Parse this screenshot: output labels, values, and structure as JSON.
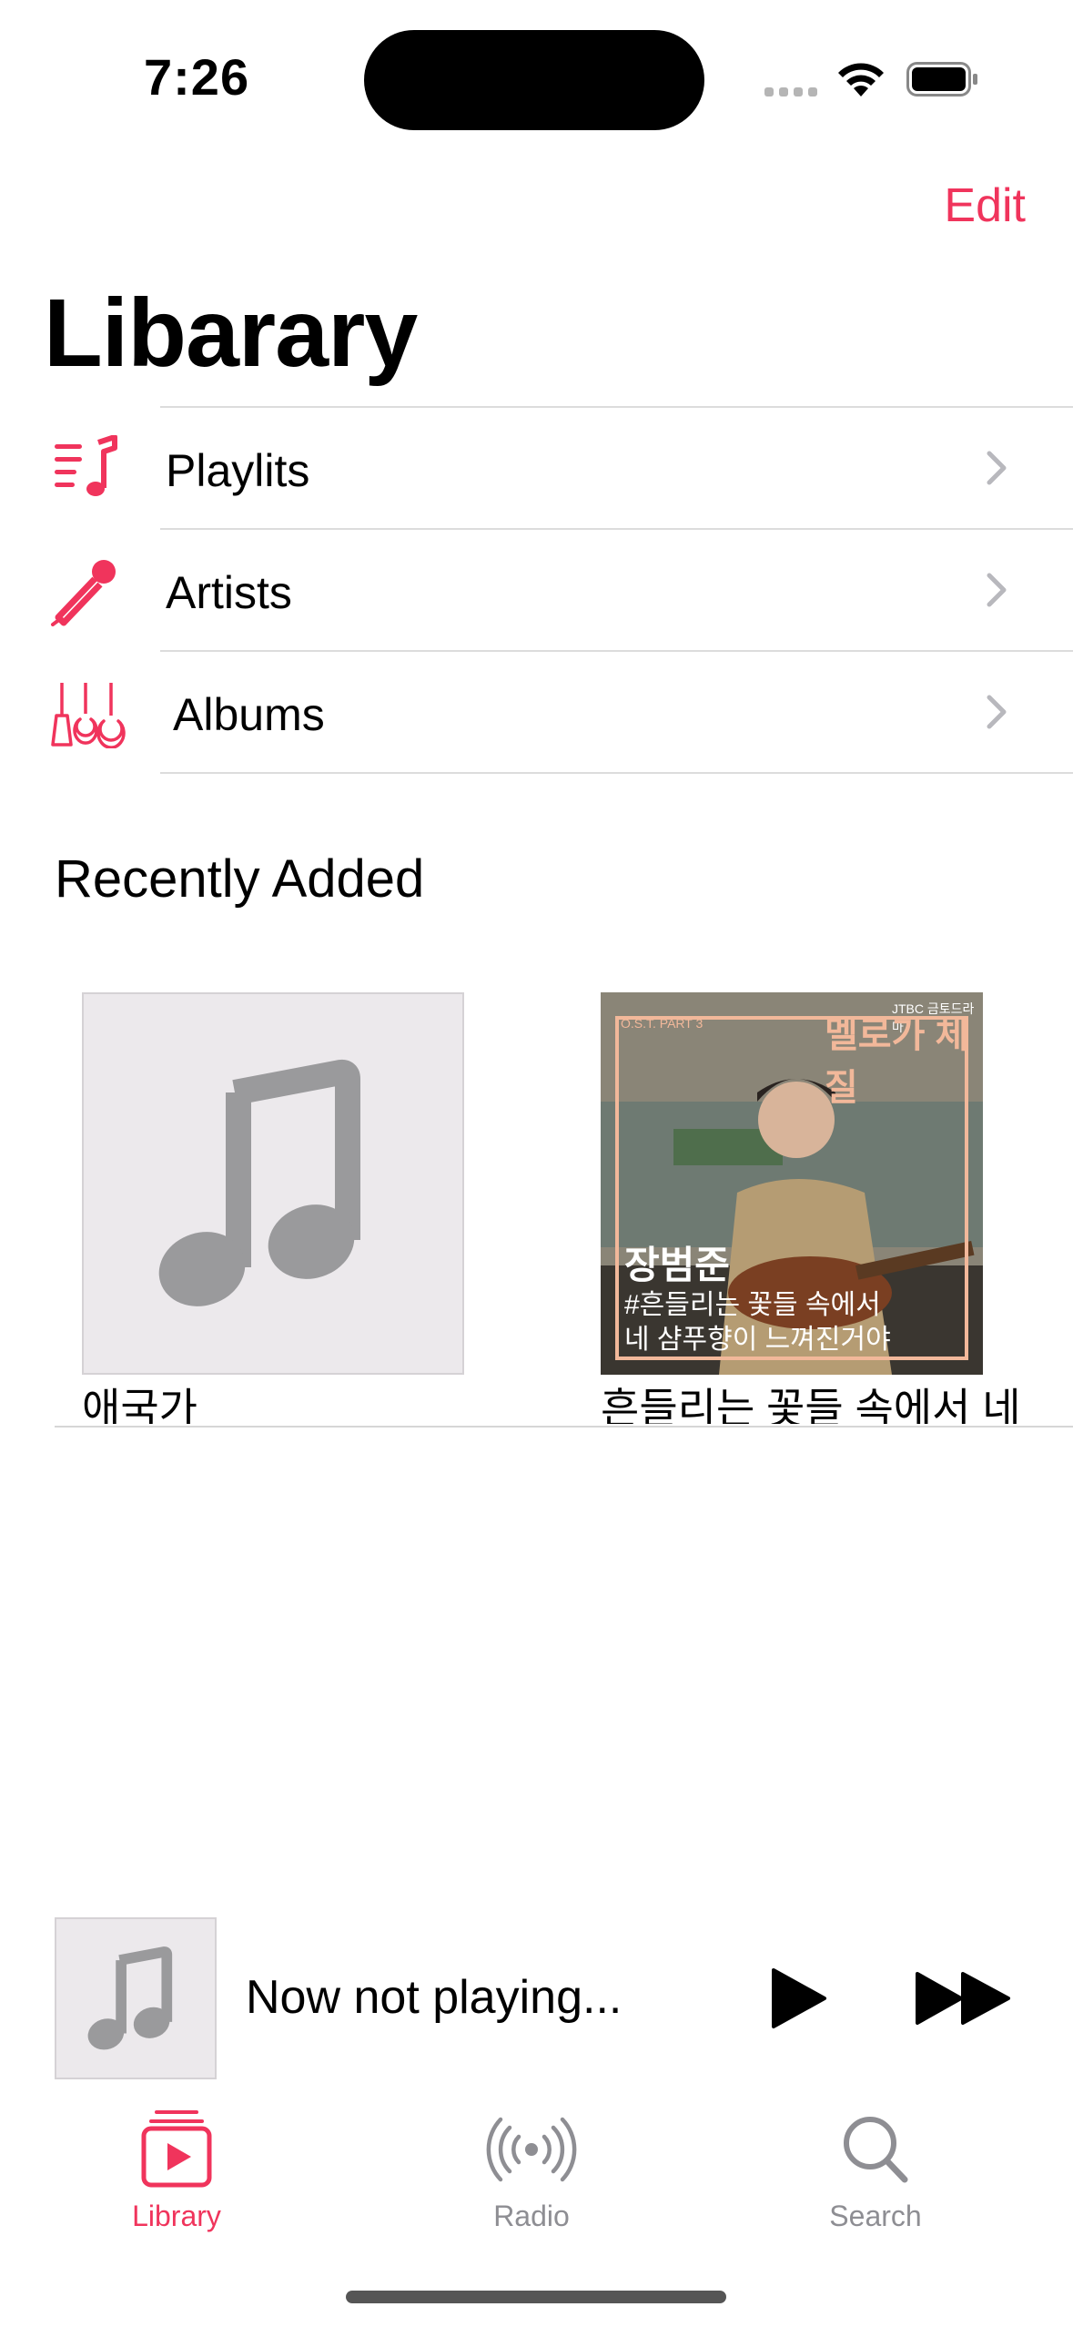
{
  "status_bar": {
    "time": "7:26"
  },
  "header": {
    "edit_label": "Edit",
    "title": "Libarary"
  },
  "library_rows": [
    {
      "label": "Playlits",
      "icon": "playlist-icon"
    },
    {
      "label": "Artists",
      "icon": "microphone-icon"
    },
    {
      "label": "Albums",
      "icon": "guitars-icon"
    }
  ],
  "recently_added": {
    "title": "Recently Added",
    "albums": [
      {
        "title": "애국가",
        "art": "music-note-placeholder"
      },
      {
        "title": "흔들리는 꽃들 속에서 네",
        "art": "album-cover",
        "cover_text": {
          "badge": "JTBC 금토드라마",
          "part": "O.S.T. PART 3",
          "show": "멜로가 체질",
          "artist": "장범준",
          "song_line1": "#흔들리는 꽃들 속에서",
          "song_line2": "네 샴푸향이 느껴진거야"
        }
      }
    ]
  },
  "mini_player": {
    "status": "Now not playing..."
  },
  "tab_bar": {
    "tabs": [
      {
        "label": "Library",
        "icon": "library-icon",
        "active": true
      },
      {
        "label": "Radio",
        "icon": "radio-icon",
        "active": false
      },
      {
        "label": "Search",
        "icon": "search-icon",
        "active": false
      }
    ]
  },
  "colors": {
    "accent": "#f0345c",
    "inactive": "#8e8e93"
  }
}
